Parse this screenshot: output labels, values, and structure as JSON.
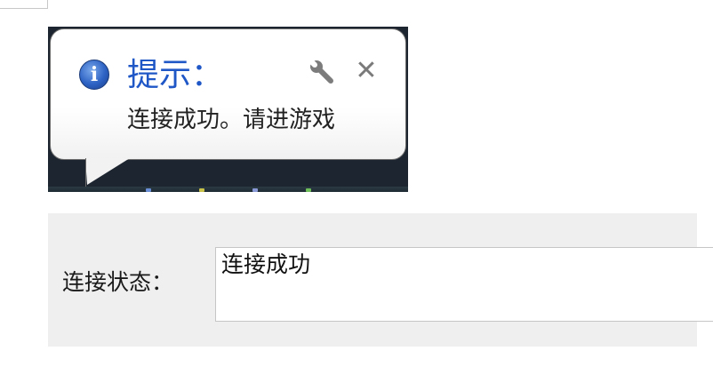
{
  "tooltip": {
    "title": "提示：",
    "message": "连接成功。请进游戏",
    "info_icon": "info-icon",
    "wrench_icon": "wrench-icon",
    "close_icon": "close-icon",
    "close_glyph": "✕",
    "info_glyph": "i"
  },
  "status": {
    "label": "连接状态：",
    "value": "连接成功"
  },
  "colors": {
    "title_blue": "#1f57c7",
    "panel_bg": "#efefef"
  }
}
